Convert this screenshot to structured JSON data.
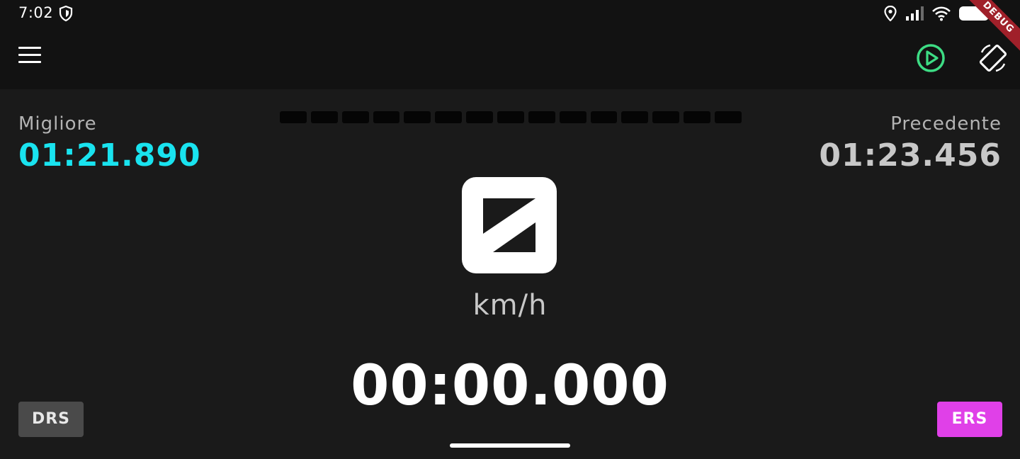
{
  "status_bar": {
    "time": "7:02",
    "debug_label": "DEBUG"
  },
  "app_bar": {
    "menu_icon": "menu-icon",
    "play_icon": "play-circle-icon",
    "rotate_icon": "screen-rotation-icon",
    "play_color": "#3ddc84"
  },
  "laps": {
    "best_label": "Migliore",
    "best_value": "01:21.890",
    "previous_label": "Precedente",
    "previous_value": "01:23.456"
  },
  "rev_lights": {
    "count": 15,
    "lit": 0
  },
  "gauge": {
    "gear_icon": "missing-glyph-icon",
    "unit": "km/h"
  },
  "timer": {
    "current": "00:00.000"
  },
  "buttons": {
    "drs_label": "DRS",
    "ers_label": "ERS"
  },
  "colors": {
    "best_accent": "#19e3ef",
    "ers_accent": "#e040e8",
    "background": "#1a1a1a"
  }
}
